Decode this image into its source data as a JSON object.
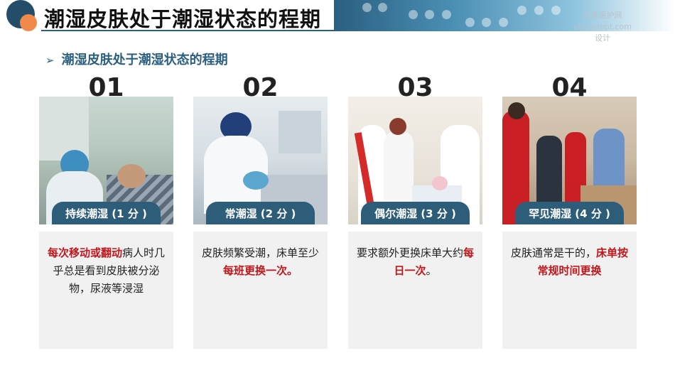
{
  "header": {
    "title": "潮湿皮肤处于潮湿状态的程期",
    "watermark": [
      "公者医护网",
      "yiyuanppt.com",
      "设计"
    ]
  },
  "subheading": {
    "arrow": "➢",
    "text": "潮湿皮肤处于潮湿状态的程期"
  },
  "cards": [
    {
      "number": "01",
      "label": "持续潮湿 (1 分 )",
      "desc_parts": [
        {
          "text": "每次移动或翻动",
          "highlight": true
        },
        {
          "text": "病人时几乎总是看到皮肤被分泌物，尿液等浸湿",
          "highlight": false
        }
      ]
    },
    {
      "number": "02",
      "label": "常潮湿 (2 分 )",
      "desc_parts": [
        {
          "text": "皮肤频繁受潮，床单至少",
          "highlight": false
        },
        {
          "text": "每班更换一次。",
          "highlight": true
        }
      ]
    },
    {
      "number": "03",
      "label": "偶尔潮湿 (3 分 )",
      "desc_parts": [
        {
          "text": "要求额外更换床单大约",
          "highlight": false
        },
        {
          "text": "每日一次",
          "highlight": true
        },
        {
          "text": "。",
          "highlight": false
        }
      ]
    },
    {
      "number": "04",
      "label": "罕见潮湿 (4 分 )",
      "desc_parts": [
        {
          "text": "皮肤通常是干的，",
          "highlight": false
        },
        {
          "text": "床单按常规时间更换",
          "highlight": true
        }
      ]
    }
  ],
  "colors": {
    "accent": "#2e5d7a",
    "highlight": "#c0171c",
    "logo_orange": "#f08a4b"
  }
}
